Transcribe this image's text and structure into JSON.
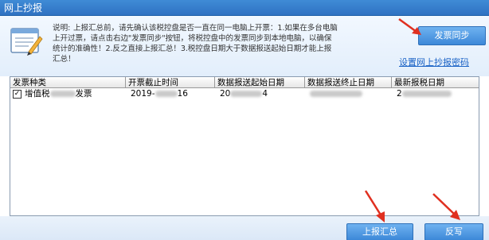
{
  "window": {
    "title": "网上抄报"
  },
  "notice": {
    "heading": "说明:",
    "line1": "上报汇总前，请先确认该税控盘是否一直在同一电脑上开票：1.如果在多台电脑",
    "line2": "上开过票，请点击右边\"发票同步\"按钮，将税控盘中的发票同步到本地电脑，以确保",
    "line3": "统计的准确性！2.反之直接上报汇总！3.税控盘日期大于数据报送起始日期才能上报",
    "line4": "汇总！"
  },
  "actions": {
    "sync_label": "发票同步",
    "password_link": "设置网上抄报密码",
    "report_label": "上报汇总",
    "writeback_label": "反写"
  },
  "table": {
    "headers": [
      "发票种类",
      "开票截止时间",
      "数据报送起始日期",
      "数据报送终止日期",
      "最新报税日期"
    ],
    "rows": [
      {
        "checked": true,
        "type_prefix": "增值税",
        "type_suffix": "发票",
        "cutoff_prefix": "2019-",
        "cutoff_suffix": "16",
        "start_prefix": "20",
        "start_suffix": "4",
        "latest_prefix": "2"
      }
    ]
  },
  "colors": {
    "titlebar": "#2f72c2",
    "button": "#3c88d8",
    "link": "#1a62c6",
    "arrow": "#e03020"
  }
}
